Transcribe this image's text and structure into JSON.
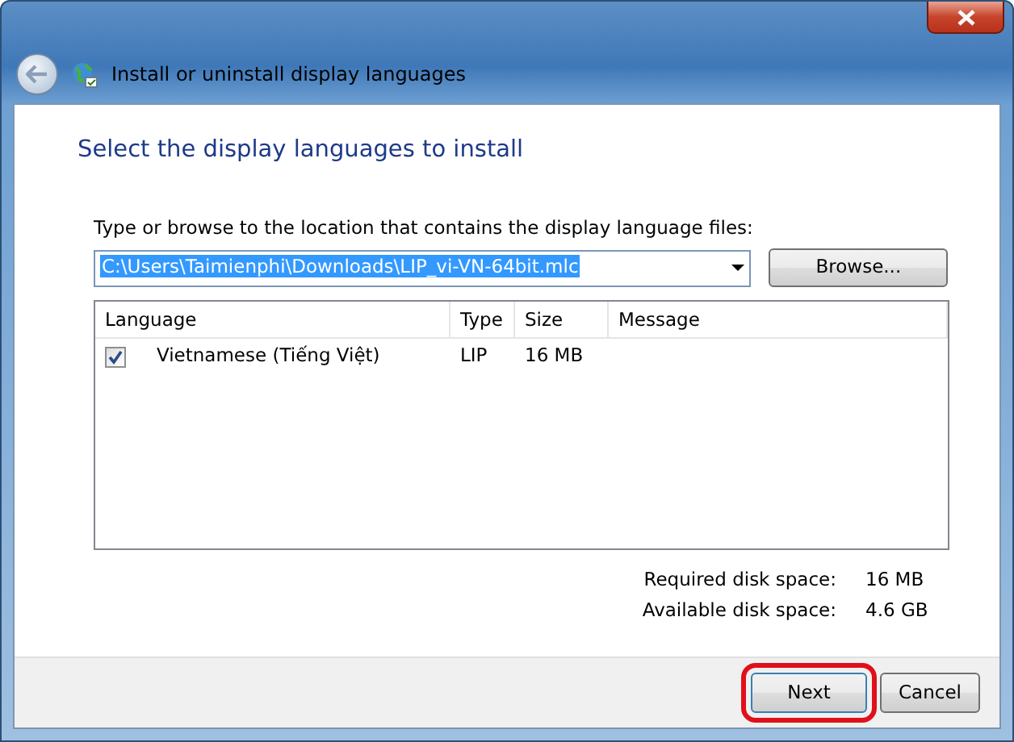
{
  "window": {
    "title": "Install or uninstall display languages"
  },
  "heading": "Select the display languages to install",
  "location": {
    "label": "Type or browse to the location that contains the display language files:",
    "value": "C:\\Users\\Taimienphi\\Downloads\\LIP_vi-VN-64bit.mlc",
    "text_selected": true,
    "browse_button": "Browse..."
  },
  "table": {
    "columns": [
      "Language",
      "Type",
      "Size",
      "Message"
    ],
    "rows": [
      {
        "checked": true,
        "language": "Vietnamese (Tiếng Việt)",
        "type": "LIP",
        "size": "16 MB",
        "message": ""
      }
    ]
  },
  "disk_space": [
    {
      "label": "Required disk space:",
      "value": "16 MB"
    },
    {
      "label": "Available disk space:",
      "value": "4.6 GB"
    }
  ],
  "buttons": [
    {
      "label": "Next",
      "highlighted": true
    },
    {
      "label": "Cancel",
      "highlighted": false
    }
  ]
}
